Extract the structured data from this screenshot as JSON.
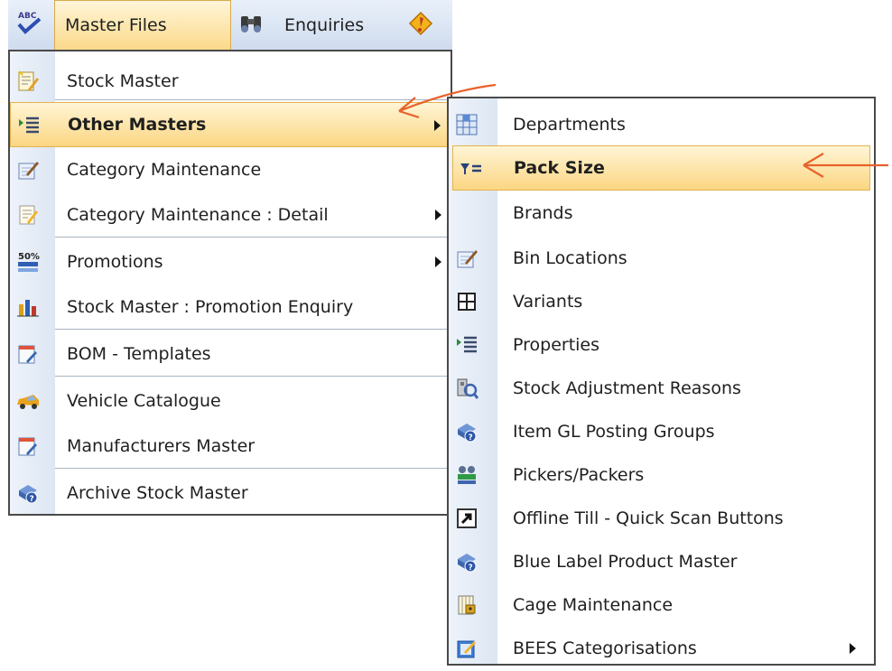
{
  "menubar": {
    "master_files": "Master Files",
    "enquiries": "Enquiries"
  },
  "master_menu": [
    {
      "label": "Stock Master",
      "icon": "stock-master-icon",
      "submenu": false
    },
    {
      "label": "Other Masters",
      "icon": "other-masters-icon",
      "submenu": true,
      "highlighted": true
    },
    {
      "label": "Category Maintenance",
      "icon": "category-maintenance-icon",
      "submenu": false
    },
    {
      "label": "Category Maintenance : Detail",
      "icon": "category-detail-icon",
      "submenu": true
    },
    {
      "label": "Promotions",
      "icon": "promotions-icon",
      "submenu": true
    },
    {
      "label": "Stock Master : Promotion Enquiry",
      "icon": "promotion-enquiry-icon",
      "submenu": false
    },
    {
      "label": "BOM - Templates",
      "icon": "bom-templates-icon",
      "submenu": false
    },
    {
      "label": "Vehicle Catalogue",
      "icon": "vehicle-icon",
      "submenu": false
    },
    {
      "label": "Manufacturers Master",
      "icon": "manufacturers-icon",
      "submenu": false
    },
    {
      "label": "Archive Stock Master",
      "icon": "archive-icon",
      "submenu": false
    }
  ],
  "other_masters_menu": [
    {
      "label": "Departments",
      "icon": "departments-icon",
      "submenu": false
    },
    {
      "label": "Pack Size",
      "icon": "pack-size-icon",
      "submenu": false,
      "highlighted": true
    },
    {
      "label": "Brands",
      "icon": "",
      "submenu": false
    },
    {
      "label": "Bin Locations",
      "icon": "bin-locations-icon",
      "submenu": false
    },
    {
      "label": "Variants",
      "icon": "variants-icon",
      "submenu": false
    },
    {
      "label": "Properties",
      "icon": "properties-icon",
      "submenu": false
    },
    {
      "label": "Stock Adjustment Reasons",
      "icon": "stock-adjustment-icon",
      "submenu": false
    },
    {
      "label": "Item GL Posting Groups",
      "icon": "gl-posting-icon",
      "submenu": false
    },
    {
      "label": "Pickers/Packers",
      "icon": "pickers-packers-icon",
      "submenu": false
    },
    {
      "label": "Offline Till - Quick Scan Buttons",
      "icon": "shortcut-icon",
      "submenu": false
    },
    {
      "label": "Blue Label Product Master",
      "icon": "blue-label-icon",
      "submenu": false
    },
    {
      "label": "Cage Maintenance",
      "icon": "cage-icon",
      "submenu": false
    },
    {
      "label": "BEES Categorisations",
      "icon": "bees-icon",
      "submenu": true
    }
  ],
  "colors": {
    "highlight_top": "#fff5d6",
    "highlight_bottom": "#fbd682",
    "annotation_arrow": "#e8622c",
    "menu_border": "#4a4a4a"
  }
}
